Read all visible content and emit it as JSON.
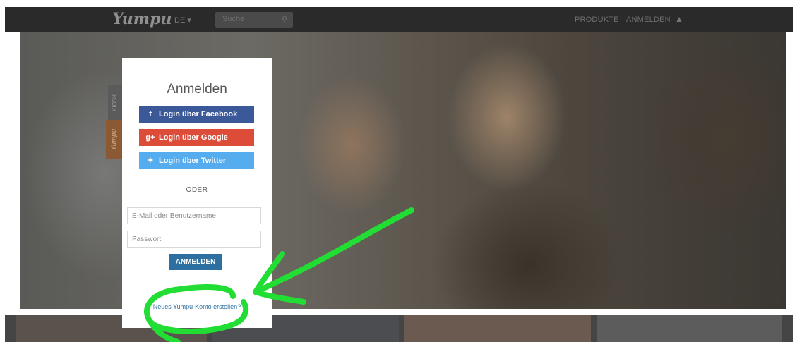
{
  "topbar": {
    "logo": "Yumpu",
    "language": "DE",
    "search_placeholder": "Suche",
    "nav_products": "PRODUKTE",
    "nav_login": "ANMELDEN"
  },
  "side_tabs": {
    "tab_a": "KIOSK",
    "tab_b": "Yumpu"
  },
  "login_modal": {
    "title": "Anmelden",
    "facebook_label": "Login über Facebook",
    "google_label": "Login über Google",
    "twitter_label": "Login über Twitter",
    "divider_label": "ODER",
    "username_placeholder": "E-Mail oder Benutzername",
    "password_placeholder": "Passwort",
    "submit_label": "ANMELDEN",
    "new_account_link": "Neues Yumpu-Konto erstellen?"
  },
  "colors": {
    "facebook": "#3b5998",
    "google": "#dd4b39",
    "twitter": "#55acee",
    "submit": "#2d6fa1",
    "annotation": "#22dd33"
  }
}
